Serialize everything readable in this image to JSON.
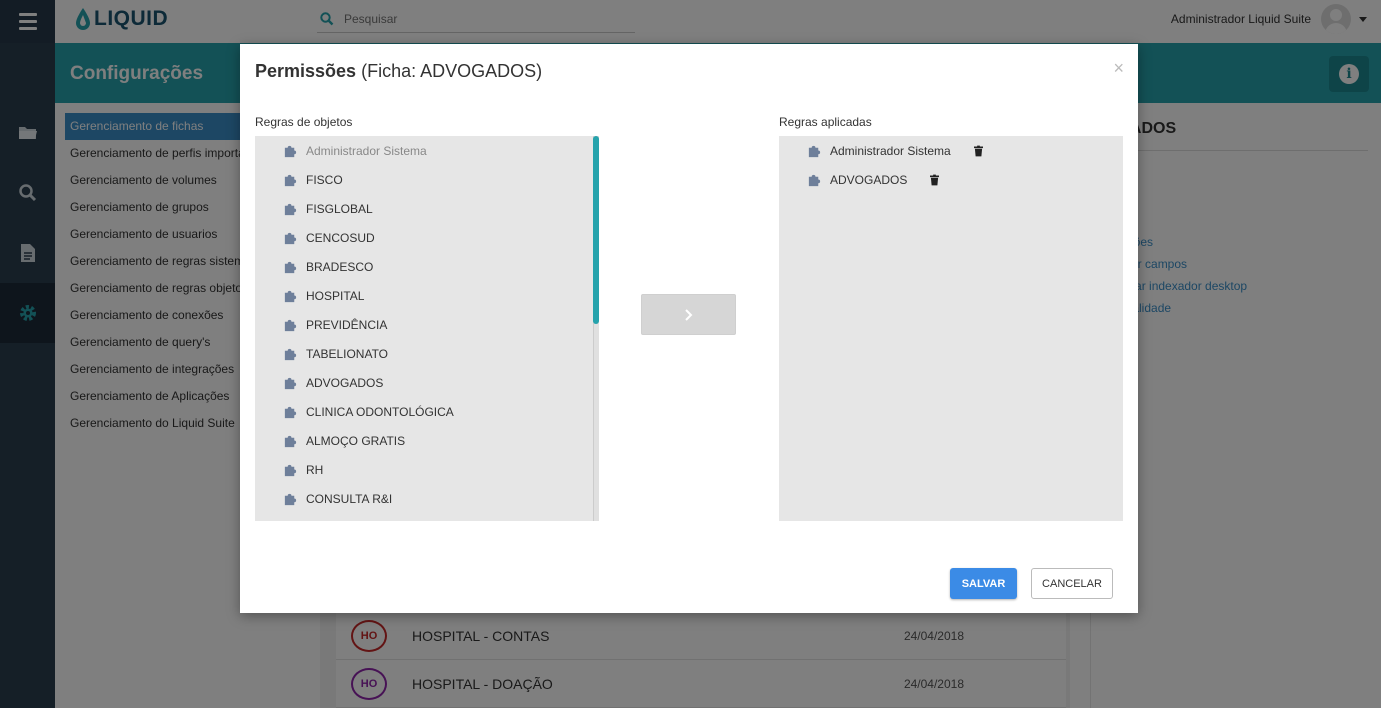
{
  "app": {
    "brand": "LIQUID",
    "search_placeholder": "Pesquisar",
    "user_name": "Administrador Liquid Suite"
  },
  "header": {
    "title": "Configurações",
    "info_glyph": "i"
  },
  "menu": {
    "items": [
      "Gerenciamento de fichas",
      "Gerenciamento de perfis importação",
      "Gerenciamento de volumes",
      "Gerenciamento de grupos",
      "Gerenciamento de usuarios",
      "Gerenciamento de regras sistema",
      "Gerenciamento de regras objetos",
      "Gerenciamento de conexões",
      "Gerenciamento de query's",
      "Gerenciamento de integrações",
      "Gerenciamento de Aplicações",
      "Gerenciamento do Liquid Suite"
    ],
    "active_index": 0
  },
  "list": {
    "rows": [
      {
        "badge": "HO",
        "badge_color": "#c62828",
        "title": "HOSPITAL - CONTAS",
        "date": "24/04/2018"
      },
      {
        "badge": "HO",
        "badge_color": "#8e24aa",
        "title": "HOSPITAL - DOAÇÃO",
        "date": "24/04/2018"
      }
    ]
  },
  "right_panel": {
    "title": "OGADOS",
    "links": [
      "ar",
      "tar",
      "cluir",
      "rmissões",
      "renciar campos",
      "nfigurar indexador desktop",
      "mporalidade"
    ]
  },
  "modal": {
    "title_bold": "Permissões",
    "title_rest": " (Ficha: ADVOGADOS)",
    "close": "×",
    "left_label": "Regras de objetos",
    "right_label": "Regras aplicadas",
    "object_rules": [
      "Administrador Sistema",
      "FISCO",
      "FISGLOBAL",
      "CENCOSUD",
      "BRADESCO",
      "HOSPITAL",
      "PREVIDÊNCIA",
      "TABELIONATO",
      "ADVOGADOS",
      "CLINICA ODONTOLÓGICA",
      "ALMOÇO GRATIS",
      "RH",
      "CONSULTA R&I"
    ],
    "applied_rules": [
      "Administrador Sistema",
      "ADVOGADOS"
    ],
    "save_label": "SALVAR",
    "cancel_label": "CANCELAR",
    "colors": {
      "accent": "#26a3ac",
      "primary": "#3b8be6",
      "puzzle_icon": "#6e7f9a"
    }
  }
}
